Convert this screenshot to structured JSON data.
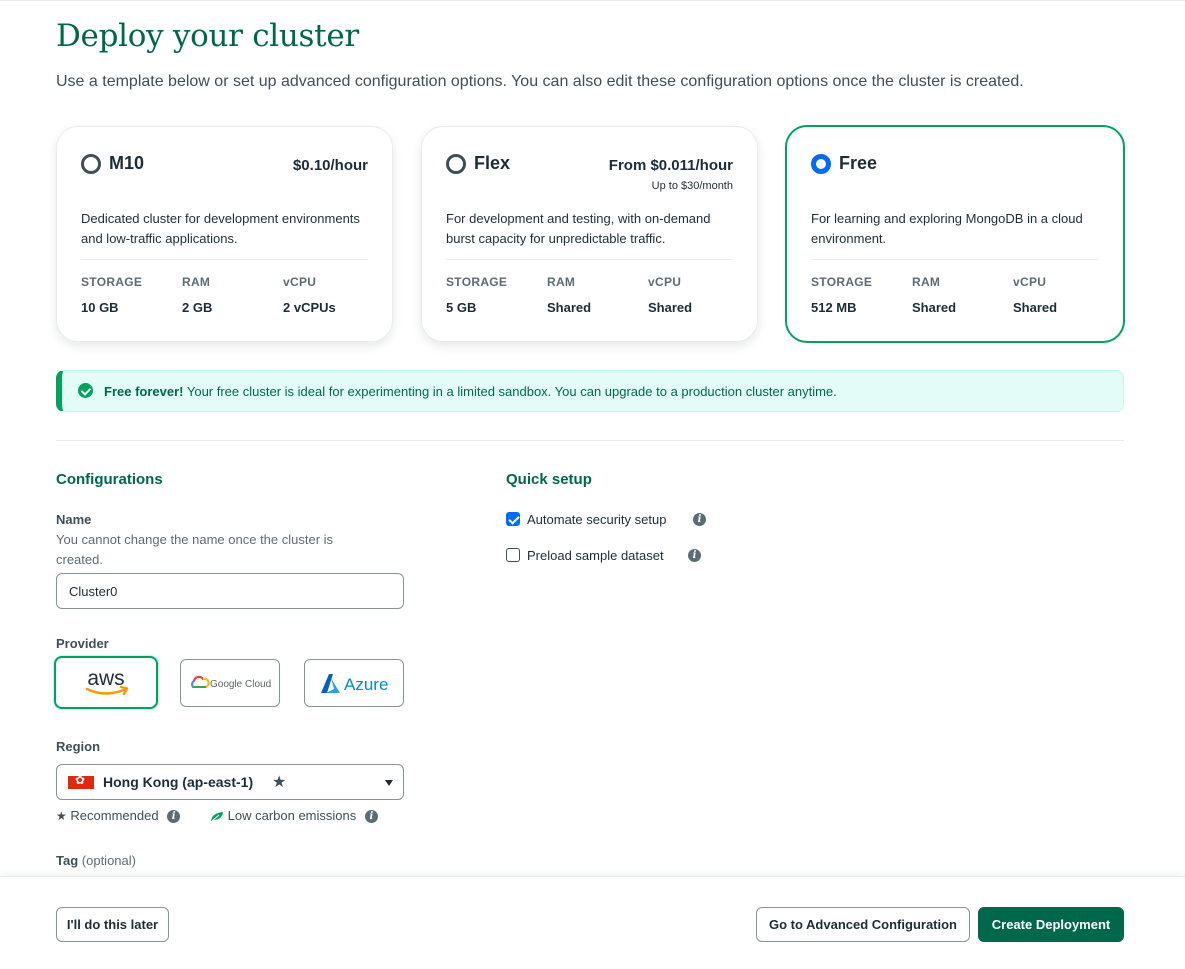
{
  "page": {
    "title": "Deploy your cluster",
    "subtitle": "Use a template below or set up advanced configuration options. You can also edit these configuration options once the cluster is created."
  },
  "tiers": [
    {
      "name": "M10",
      "price": "$0.10/hour",
      "price_sub": "",
      "description": "Dedicated cluster for development environments and low-traffic applications.",
      "storage_label": "STORAGE",
      "storage": "10 GB",
      "ram_label": "RAM",
      "ram": "2 GB",
      "vcpu_label": "vCPU",
      "vcpu": "2 vCPUs",
      "selected": false
    },
    {
      "name": "Flex",
      "price": "From $0.011/hour",
      "price_sub": "Up to $30/month",
      "description": "For development and testing, with on-demand burst capacity for unpredictable traffic.",
      "storage_label": "STORAGE",
      "storage": "5 GB",
      "ram_label": "RAM",
      "ram": "Shared",
      "vcpu_label": "vCPU",
      "vcpu": "Shared",
      "selected": false
    },
    {
      "name": "Free",
      "price": "",
      "price_sub": "",
      "description": "For learning and exploring MongoDB in a cloud environment.",
      "storage_label": "STORAGE",
      "storage": "512 MB",
      "ram_label": "RAM",
      "ram": "Shared",
      "vcpu_label": "vCPU",
      "vcpu": "Shared",
      "selected": true
    }
  ],
  "banner": {
    "bold": "Free forever!",
    "text": " Your free cluster is ideal for experimenting in a limited sandbox. You can upgrade to a production cluster anytime."
  },
  "configurations": {
    "title": "Configurations",
    "name_label": "Name",
    "name_helper": "You cannot change the name once the cluster is created.",
    "name_value": "Cluster0",
    "provider_label": "Provider",
    "providers": [
      {
        "name": "aws",
        "selected": true
      },
      {
        "name": "Google Cloud",
        "selected": false
      },
      {
        "name": "Azure",
        "selected": false
      }
    ],
    "region_label": "Region",
    "region_value": "Hong Kong (ap-east-1)",
    "recommended_label": "Recommended",
    "low_carbon_label": "Low carbon emissions",
    "tag_label": "Tag",
    "tag_optional": "(optional)"
  },
  "quick_setup": {
    "title": "Quick setup",
    "options": [
      {
        "label": "Automate security setup",
        "checked": true
      },
      {
        "label": "Preload sample dataset",
        "checked": false
      }
    ]
  },
  "footer": {
    "later_label": "I'll do this later",
    "advanced_label": "Go to Advanced Configuration",
    "create_label": "Create Deployment"
  },
  "colors": {
    "brand_green": "#00684a",
    "accent_green": "#00a35c",
    "radio_blue": "#016bf8",
    "banner_bg": "#e3fcf7"
  }
}
